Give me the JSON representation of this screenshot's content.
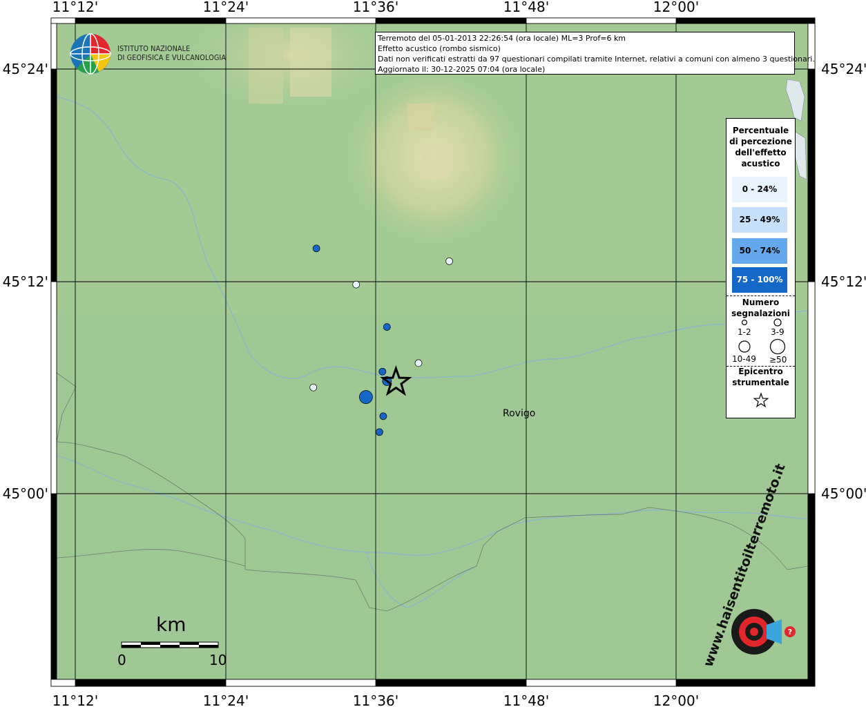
{
  "info": {
    "line1": "Terremoto del 05-01-2013 22:26:54 (ora locale) ML=3 Prof=6 km",
    "line2": "Effetto acustico (rombo sismico)",
    "line3": "Dati non verificati estratti da 97 questionari compilati tramite Internet, relativi a comuni con almeno 3 questionari.",
    "line4": "Aggiornato il: 30-12-2025 07:04 (ora locale)"
  },
  "logo": {
    "line1": "ISTITUTO NAZIONALE",
    "line2": "DI GEOFISICA E VULCANOLOGIA"
  },
  "axes": {
    "top": [
      "11°12'",
      "11°24'",
      "11°36'",
      "11°48'",
      "12°00'"
    ],
    "bottom": [
      "11°12'",
      "11°24'",
      "11°36'",
      "11°48'",
      "12°00'"
    ],
    "left": [
      "45°24'",
      "45°12'",
      "45°00'"
    ],
    "right": [
      "45°24'",
      "45°12'",
      "45°00'"
    ]
  },
  "city": "Rovigo",
  "scale": {
    "title": "km",
    "min": "0",
    "max": "10"
  },
  "legend": {
    "title_lines": [
      "Percentuale",
      "di percezione",
      "dell'effetto",
      "acustico"
    ],
    "classes": [
      {
        "label": "0 - 24%",
        "color": "#e9f3fd"
      },
      {
        "label": "25 - 49%",
        "color": "#c6e0f9"
      },
      {
        "label": "50 - 74%",
        "color": "#63a8ec"
      },
      {
        "label": "75 - 100%",
        "color": "#1668c8"
      }
    ],
    "count_title_lines": [
      "Numero",
      "segnalazioni"
    ],
    "count_labels": [
      "1-2",
      "3-9",
      "10-49",
      "≥50"
    ],
    "epicenter_title_lines": [
      "Epicentro",
      "strumentale"
    ]
  },
  "colors": {
    "plain": "#9fc894",
    "hills": "#c9d6a0",
    "point_high": "#1668c8",
    "point_low": "#e9f3fd"
  },
  "observations": [
    {
      "lon": 11.698,
      "lat": 45.219,
      "size": "1-2",
      "class": "0 - 24%"
    },
    {
      "lon": 11.521,
      "lat": 45.231,
      "size": "1-2",
      "class": "75 - 100%"
    },
    {
      "lon": 11.574,
      "lat": 45.197,
      "size": "1-2",
      "class": "0 - 24%"
    },
    {
      "lon": 11.615,
      "lat": 45.157,
      "size": "1-2",
      "class": "75 - 100%"
    },
    {
      "lon": 11.657,
      "lat": 45.123,
      "size": "1-2",
      "class": "0 - 24%"
    },
    {
      "lon": 11.609,
      "lat": 45.115,
      "size": "1-2",
      "class": "75 - 100%"
    },
    {
      "lon": 11.615,
      "lat": 45.106,
      "size": "3-9",
      "class": "75 - 100%"
    },
    {
      "lon": 11.517,
      "lat": 45.1,
      "size": "1-2",
      "class": "0 - 24%"
    },
    {
      "lon": 11.587,
      "lat": 45.091,
      "size": "10-49",
      "class": "75 - 100%"
    },
    {
      "lon": 11.61,
      "lat": 45.073,
      "size": "1-2",
      "class": "75 - 100%"
    },
    {
      "lon": 11.605,
      "lat": 45.058,
      "size": "1-2",
      "class": "75 - 100%"
    }
  ],
  "epicenter": {
    "lon": 11.627,
    "lat": 45.105
  },
  "branding": {
    "site": "www.haisentitoilterremoto.it"
  }
}
